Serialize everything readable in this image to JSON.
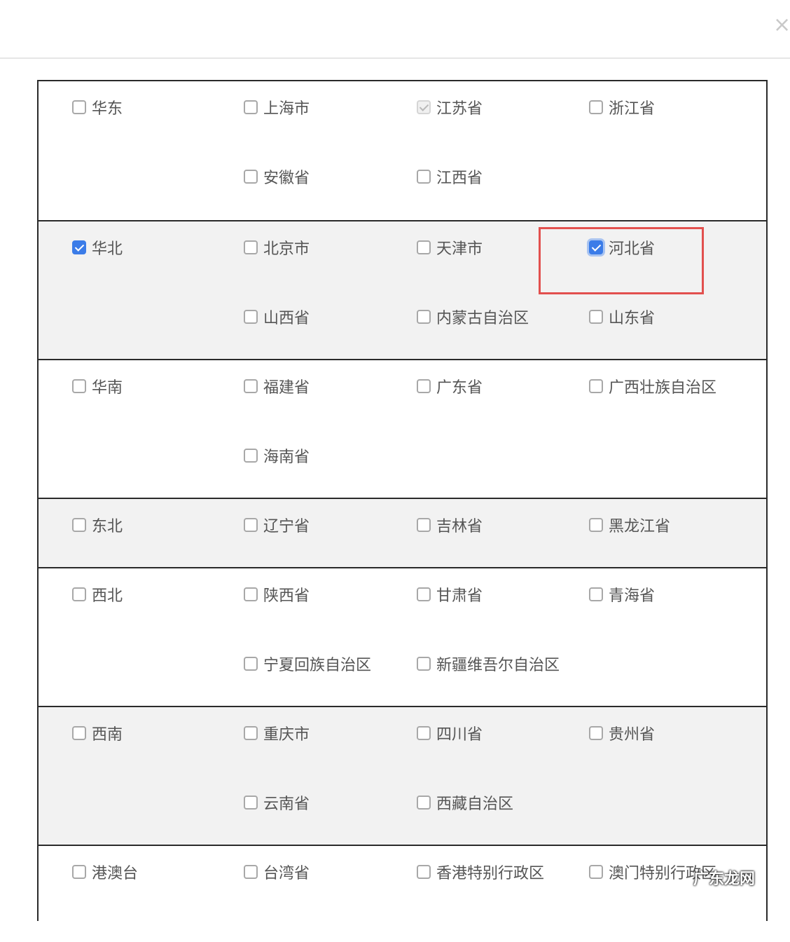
{
  "dialog": {
    "close_icon": "close-icon",
    "close_glyph": "×"
  },
  "regions": [
    {
      "region": {
        "label": "华东",
        "checked": false
      },
      "provinces": [
        {
          "label": "上海市",
          "state": "unchecked"
        },
        {
          "label": "江苏省",
          "state": "disabled-checked"
        },
        {
          "label": "浙江省",
          "state": "unchecked"
        },
        {
          "label": "安徽省",
          "state": "unchecked"
        },
        {
          "label": "江西省",
          "state": "unchecked"
        }
      ]
    },
    {
      "region": {
        "label": "华北",
        "checked": true
      },
      "provinces": [
        {
          "label": "北京市",
          "state": "unchecked"
        },
        {
          "label": "天津市",
          "state": "unchecked"
        },
        {
          "label": "河北省",
          "state": "checked"
        },
        {
          "label": "山西省",
          "state": "unchecked"
        },
        {
          "label": "内蒙古自治区",
          "state": "unchecked"
        },
        {
          "label": "山东省",
          "state": "unchecked"
        }
      ]
    },
    {
      "region": {
        "label": "华南",
        "checked": false
      },
      "provinces": [
        {
          "label": "福建省",
          "state": "unchecked"
        },
        {
          "label": "广东省",
          "state": "unchecked"
        },
        {
          "label": "广西壮族自治区",
          "state": "unchecked"
        },
        {
          "label": "海南省",
          "state": "unchecked"
        }
      ]
    },
    {
      "region": {
        "label": "东北",
        "checked": false
      },
      "provinces": [
        {
          "label": "辽宁省",
          "state": "unchecked"
        },
        {
          "label": "吉林省",
          "state": "unchecked"
        },
        {
          "label": "黑龙江省",
          "state": "unchecked"
        }
      ]
    },
    {
      "region": {
        "label": "西北",
        "checked": false
      },
      "provinces": [
        {
          "label": "陕西省",
          "state": "unchecked"
        },
        {
          "label": "甘肃省",
          "state": "unchecked"
        },
        {
          "label": "青海省",
          "state": "unchecked"
        },
        {
          "label": "宁夏回族自治区",
          "state": "unchecked"
        },
        {
          "label": "新疆维吾尔自治区",
          "state": "unchecked"
        }
      ]
    },
    {
      "region": {
        "label": "西南",
        "checked": false
      },
      "provinces": [
        {
          "label": "重庆市",
          "state": "unchecked"
        },
        {
          "label": "四川省",
          "state": "unchecked"
        },
        {
          "label": "贵州省",
          "state": "unchecked"
        },
        {
          "label": "云南省",
          "state": "unchecked"
        },
        {
          "label": "西藏自治区",
          "state": "unchecked"
        }
      ]
    },
    {
      "region": {
        "label": "港澳台",
        "checked": false
      },
      "provinces": [
        {
          "label": "台湾省",
          "state": "unchecked"
        },
        {
          "label": "香港特别行政区",
          "state": "unchecked"
        },
        {
          "label": "澳门特别行政区",
          "state": "unchecked"
        }
      ]
    }
  ],
  "watermark": "广东龙网",
  "colors": {
    "checkbox_checked": "#3b7ce8",
    "highlight_box": "#e2504e",
    "row_gray": "#f2f2f2"
  }
}
